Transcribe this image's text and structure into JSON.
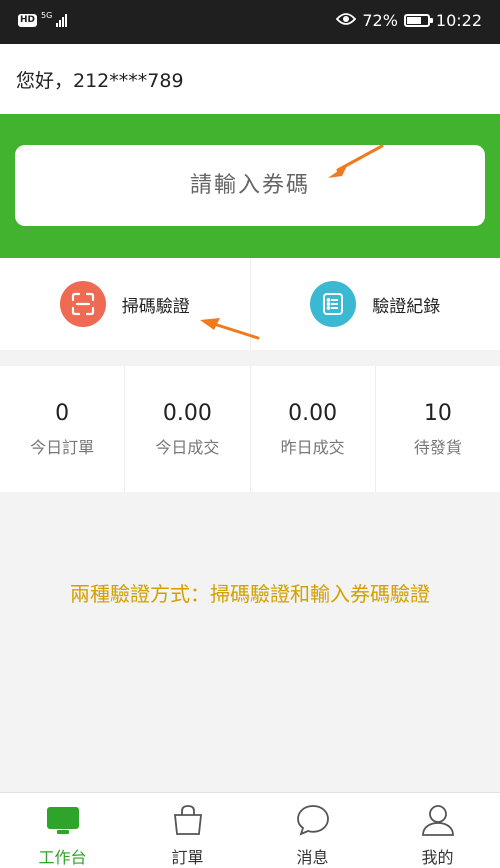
{
  "status_bar": {
    "hd": "HD",
    "network": "5G",
    "battery_percent": "72%",
    "battery_level": 0.72,
    "time": "10:22"
  },
  "greeting": "您好，212****789",
  "coupon_input": {
    "placeholder": "請輸入券碼",
    "value": ""
  },
  "actions": {
    "scan": {
      "label": "掃碼驗證",
      "color": "#ef6a52"
    },
    "record": {
      "label": "驗證紀錄",
      "color": "#3bb9d3"
    }
  },
  "stats": [
    {
      "value": "0",
      "label": "今日訂單"
    },
    {
      "value": "0.00",
      "label": "今日成交"
    },
    {
      "value": "0.00",
      "label": "昨日成交"
    },
    {
      "value": "10",
      "label": "待發貨"
    }
  ],
  "note": "兩種驗證方式：掃碼驗證和輸入券碼驗證",
  "nav": [
    {
      "label": "工作台",
      "icon": "workbench-icon",
      "active": true
    },
    {
      "label": "訂單",
      "icon": "shopping-bag-icon",
      "active": false
    },
    {
      "label": "消息",
      "icon": "chat-bubble-icon",
      "active": false
    },
    {
      "label": "我的",
      "icon": "user-icon",
      "active": false
    }
  ],
  "colors": {
    "primary_green": "#42b32e",
    "active_nav": "#2fa42b",
    "note_gold": "#d4a000",
    "arrow_orange": "#f07a1e"
  }
}
